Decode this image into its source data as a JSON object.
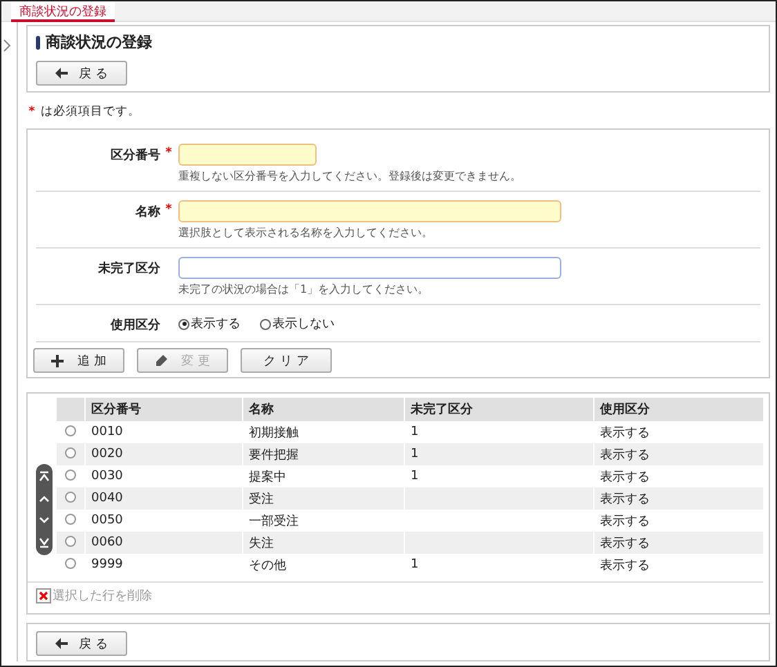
{
  "tab": {
    "label": "商談状況の登録",
    "selected": true
  },
  "heading": "商談状況の登録",
  "back_button": {
    "label": "戻 る"
  },
  "required_note": {
    "mark": "*",
    "text": "は必須項目です。"
  },
  "form": [
    {
      "kind": "short_text",
      "label": "区分番号",
      "required": true,
      "hint": "重複しない区分番号を入力してください。登録後は変更できません。"
    },
    {
      "kind": "text",
      "label": "名称",
      "required": true,
      "hint": "選択肢として表示される名称を入力してください。"
    },
    {
      "kind": "text",
      "label": "未完了区分",
      "required": false,
      "hint": "未完了の状況の場合は「1」を入力してください。"
    },
    {
      "kind": "radio",
      "label": "使用区分",
      "options": [
        {
          "label": "表示する",
          "selected": true
        },
        {
          "label": "表示しない",
          "selected": false
        }
      ]
    }
  ],
  "form_buttons": [
    {
      "kind": "add",
      "label": "追 加",
      "disabled": false
    },
    {
      "kind": "edit",
      "label": "変 更",
      "disabled": true
    },
    {
      "kind": "clear",
      "label": "ク リ ア",
      "disabled": false
    }
  ],
  "table": {
    "columns": [
      "区分番号",
      "名称",
      "未完了区分",
      "使用区分"
    ],
    "rows": [
      {
        "selected": false,
        "cells": [
          "0010",
          "初期接触",
          "1",
          "表示する"
        ]
      },
      {
        "selected": false,
        "cells": [
          "0020",
          "要件把握",
          "1",
          "表示する"
        ]
      },
      {
        "selected": false,
        "cells": [
          "0030",
          "提案中",
          "1",
          "表示する"
        ]
      },
      {
        "selected": false,
        "cells": [
          "0040",
          "受注",
          "",
          "表示する"
        ]
      },
      {
        "selected": false,
        "cells": [
          "0050",
          "一部受注",
          "",
          "表示する"
        ]
      },
      {
        "selected": false,
        "cells": [
          "0060",
          "失注",
          "",
          "表示する"
        ]
      },
      {
        "selected": false,
        "cells": [
          "9999",
          "その他",
          "1",
          "表示する"
        ]
      }
    ]
  },
  "delete_link": {
    "label": "選択した行を削除",
    "disabled": true
  },
  "bottom_back_button": {
    "label": "戻 る"
  }
}
